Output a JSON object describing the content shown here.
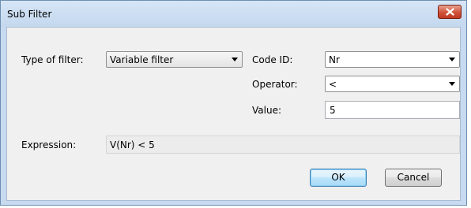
{
  "window": {
    "title": "Sub Filter"
  },
  "form": {
    "filter_type": {
      "label": "Type of filter:",
      "value": "Variable filter"
    },
    "code_id": {
      "label": "Code ID:",
      "value": "Nr"
    },
    "operator": {
      "label": "Operator:",
      "value": "<"
    },
    "value": {
      "label": "Value:",
      "value": "5"
    },
    "expression": {
      "label": "Expression:",
      "value": "V(Nr) < 5"
    }
  },
  "buttons": {
    "ok": "OK",
    "cancel": "Cancel"
  },
  "icons": {
    "close": "close-icon",
    "dropdown": "chevron-down-icon"
  },
  "colors": {
    "close_button": "#c9462c",
    "default_button_border": "#3c7fb1",
    "frame": "#c7daf0",
    "dialog_bg": "#f0f0f0"
  }
}
